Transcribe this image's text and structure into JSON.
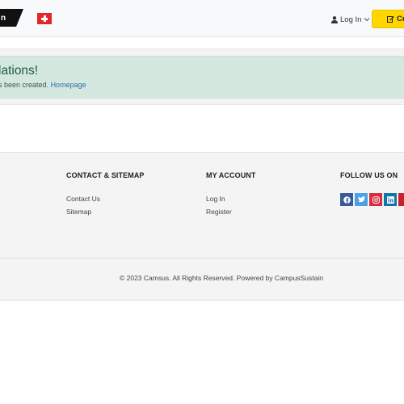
{
  "header": {
    "login_label": "Log In",
    "create_label": "Cre",
    "colors": {
      "accent": "#ffd600",
      "logo": "#111111",
      "flag": "#e3262b"
    }
  },
  "alert": {
    "title": "lations!",
    "message": "s been created.",
    "link": "Homepage",
    "colors": {
      "background": "#d4e8df",
      "title": "#1d5c3a"
    }
  },
  "footer": {
    "columns": [
      {
        "title": "CONTACT & SITEMAP",
        "links": [
          "Contact Us",
          "Sitemap"
        ]
      },
      {
        "title": "MY ACCOUNT",
        "links": [
          "Log In",
          "Register"
        ]
      },
      {
        "title": "FOLLOW US ON",
        "links": []
      }
    ],
    "social_icons": [
      {
        "name": "facebook-icon",
        "color": "#3b5998"
      },
      {
        "name": "twitter-icon",
        "color": "#4aa1e8"
      },
      {
        "name": "instagram-icon",
        "color": "#d32f3f"
      },
      {
        "name": "linkedin-icon",
        "color": "#0e76a8"
      },
      {
        "name": "pinterest-icon",
        "color": "#c8232c"
      }
    ],
    "copyright": "© 2023 Camsus. All Rights Reserved. Powered by CampusSustain"
  }
}
